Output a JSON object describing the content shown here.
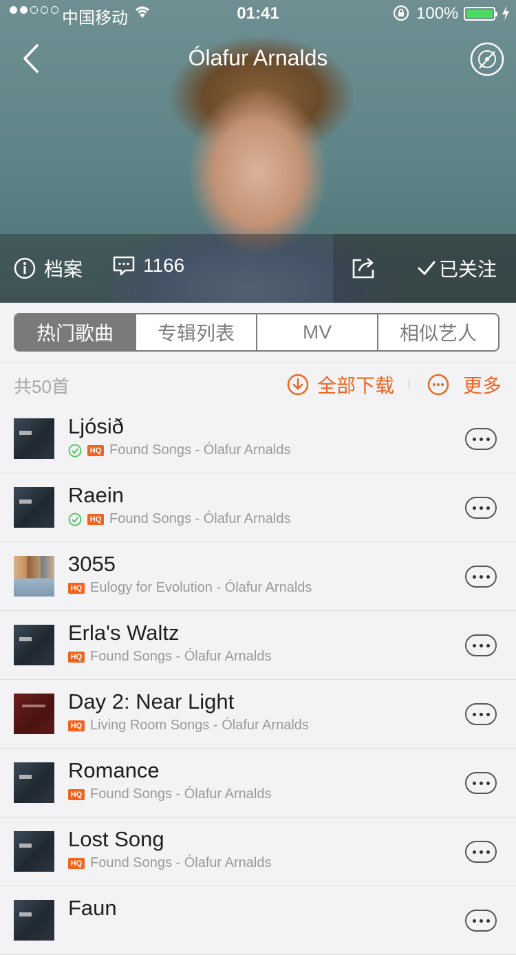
{
  "status_bar": {
    "carrier": "中国移动",
    "time": "01:41",
    "battery_pct": "100%",
    "battery_color": "#4cd964",
    "signal_strength": 2
  },
  "nav": {
    "title": "Ólafur Arnalds",
    "back_icon": "chevron-left-icon",
    "right_icon": "disc-icon"
  },
  "hero_bar": {
    "profile_label": "档案",
    "comments_count": "1166",
    "follow_label": "已关注"
  },
  "tabs": [
    {
      "label": "热门歌曲",
      "active": true
    },
    {
      "label": "专辑列表",
      "active": false
    },
    {
      "label": "MV",
      "active": false
    },
    {
      "label": "相似艺人",
      "active": false
    }
  ],
  "summary": {
    "count": "共50首",
    "download_all": "全部下载",
    "more": "更多",
    "accent_color": "#f0641e"
  },
  "hq_badge": "HQ",
  "songs": [
    {
      "title": "Ljósið",
      "subtitle": "Found Songs - Ólafur Arnalds",
      "downloaded": true,
      "cover": "dark"
    },
    {
      "title": "Raein",
      "subtitle": "Found Songs - Ólafur Arnalds",
      "downloaded": true,
      "cover": "dark"
    },
    {
      "title": "3055",
      "subtitle": "Eulogy for Evolution - Ólafur Arnalds",
      "downloaded": false,
      "cover": "colorful"
    },
    {
      "title": "Erla's Waltz",
      "subtitle": "Found Songs - Ólafur Arnalds",
      "downloaded": false,
      "cover": "dark"
    },
    {
      "title": "Day 2: Near Light",
      "subtitle": "Living Room Songs - Ólafur Arnalds",
      "downloaded": false,
      "cover": "red"
    },
    {
      "title": "Romance",
      "subtitle": "Found Songs - Ólafur Arnalds",
      "downloaded": false,
      "cover": "dark"
    },
    {
      "title": "Lost Song",
      "subtitle": "Found Songs - Ólafur Arnalds",
      "downloaded": false,
      "cover": "dark"
    },
    {
      "title": "Faun",
      "subtitle": "",
      "downloaded": false,
      "cover": "dark"
    }
  ]
}
